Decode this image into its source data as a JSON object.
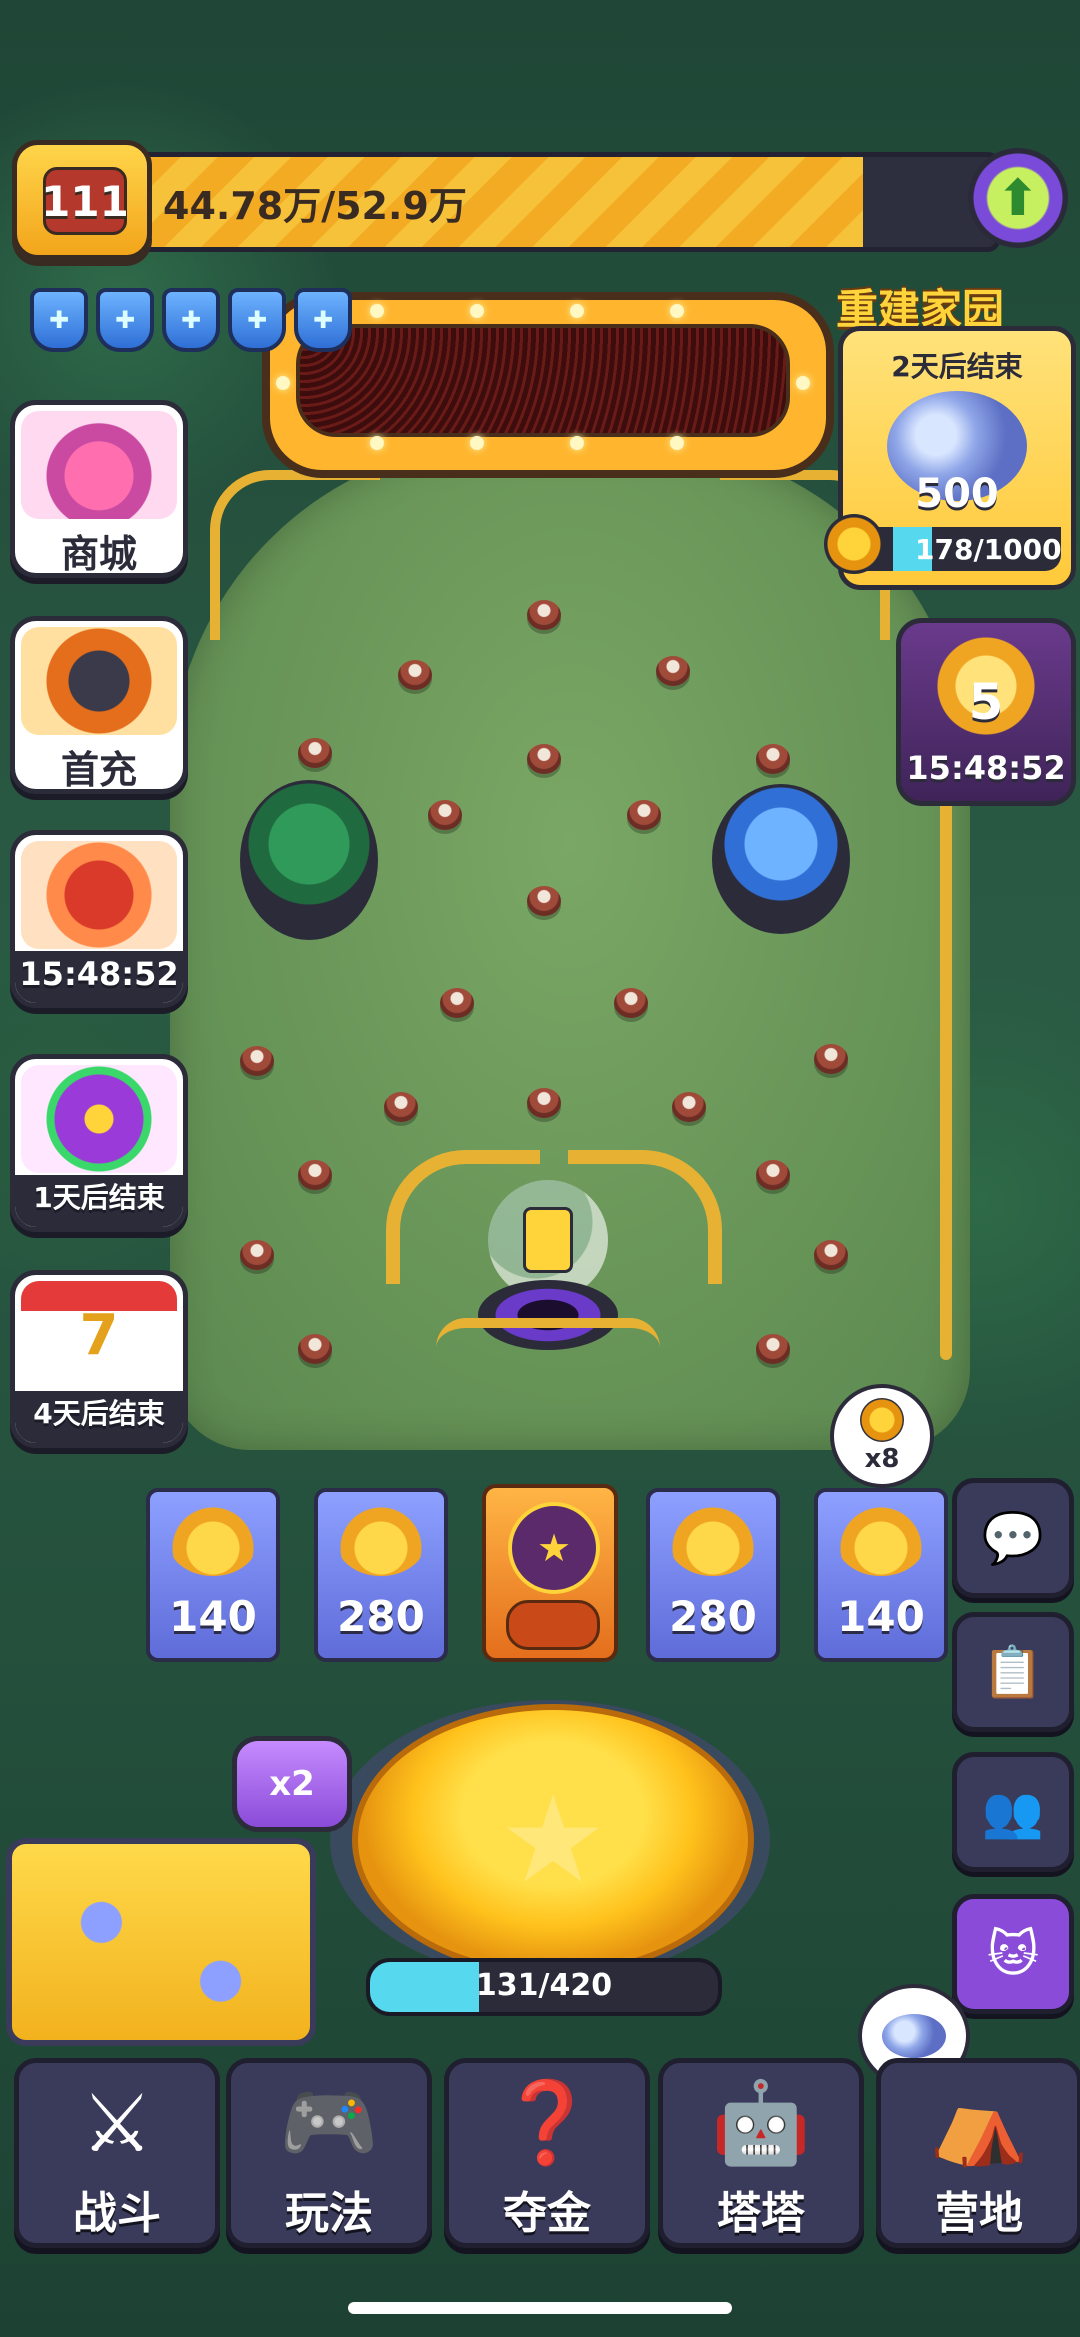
{
  "header": {
    "level": "111",
    "xp_text": "44.78万/52.9万",
    "xp_progress": 0.846,
    "shield_count": 5
  },
  "event": {
    "title": "重建家园",
    "subtitle": "2天后结束",
    "reward_count": "500",
    "progress_text": "178/1000",
    "progress": 0.178
  },
  "trophy": {
    "rank": "5",
    "timer": "15:48:52"
  },
  "left_menu": {
    "shop_label": "商城",
    "first_charge_label": "首充",
    "bird_timer": "15:48:52",
    "wheel_label": "1天后结束",
    "calendar_label": "4天后结束"
  },
  "key_badge": "x8",
  "slots": [
    "140",
    "280",
    "280",
    "140"
  ],
  "multiplier": "x2",
  "energy": {
    "text": "131/420",
    "progress": 0.312
  },
  "nav": [
    {
      "label": "战斗",
      "icon": "crossed-swords-icon"
    },
    {
      "label": "玩法",
      "icon": "gamepad-icon"
    },
    {
      "label": "夺金",
      "icon": "mystery-box-icon"
    },
    {
      "label": "塔塔",
      "icon": "robot-cat-icon"
    },
    {
      "label": "营地",
      "icon": "tent-icon"
    }
  ],
  "colors": {
    "accent_gold": "#ffc21c",
    "energy_cyan": "#56d9ee",
    "panel_dark": "#3a3a5a"
  }
}
